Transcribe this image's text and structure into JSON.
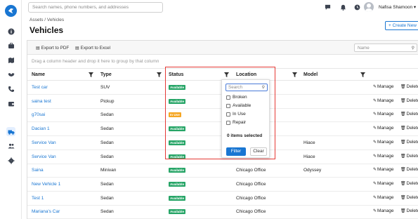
{
  "header": {
    "search_placeholder": "Search names, phone numbers, and addresses",
    "user_name": "Nafisa Shamoon",
    "breadcrumb": "Assets / Vehicles",
    "title": "Vehicles",
    "create_button": "+ Create New"
  },
  "toolbar": {
    "export_pdf": "Export to PDF",
    "export_excel": "Export to Excel",
    "search_placeholder": "Name"
  },
  "group_hint": "Drag a column header and drop it here to group by that column",
  "columns": {
    "name": "Name",
    "type": "Type",
    "status": "Status",
    "location": "Location",
    "model": "Model"
  },
  "actions": {
    "manage": "Manage",
    "delete": "Delete"
  },
  "status_colors": {
    "Available": "#27a567",
    "In Use": "#f5a623"
  },
  "rows": [
    {
      "name": "Test car",
      "type": "SUV",
      "status": "Available",
      "location": "",
      "model": ""
    },
    {
      "name": "saina test",
      "type": "Pickup",
      "status": "Available",
      "location": "",
      "model": ""
    },
    {
      "name": "g70sai",
      "type": "Sedan",
      "status": "In Use",
      "location": "",
      "model": ""
    },
    {
      "name": "Dacian 1",
      "type": "Sedan",
      "status": "Available",
      "location": "",
      "model": ""
    },
    {
      "name": "Service Van",
      "type": "Sedan",
      "status": "Available",
      "location": "",
      "model": "Hiace"
    },
    {
      "name": "Service Van",
      "type": "Sedan",
      "status": "Available",
      "location": "",
      "model": "Hiace"
    },
    {
      "name": "Saina",
      "type": "Minivan",
      "status": "Available",
      "location": "Chicago Office",
      "model": "Odyssey"
    },
    {
      "name": "New Vehicle 1",
      "type": "Sedan",
      "status": "Available",
      "location": "Chicago Office",
      "model": ""
    },
    {
      "name": "Test 1",
      "type": "Sedan",
      "status": "Available",
      "location": "Chicago Office",
      "model": ""
    },
    {
      "name": "Mariana's Car",
      "type": "Sedan",
      "status": "Available",
      "location": "Chicago Office",
      "model": ""
    }
  ],
  "status_filter": {
    "search_placeholder": "Search",
    "options": [
      "Broken",
      "Available",
      "In Use",
      "Repair"
    ],
    "selected_count": "0 items selected",
    "filter_button": "Filter",
    "clear_button": "Clear"
  },
  "sidebar": {
    "icons": [
      "info-icon",
      "briefcase-icon",
      "map-icon",
      "handshake-icon",
      "phone-icon",
      "wallet-icon",
      "truck-icon",
      "users-icon",
      "settings-icon"
    ],
    "active": "truck-icon"
  }
}
